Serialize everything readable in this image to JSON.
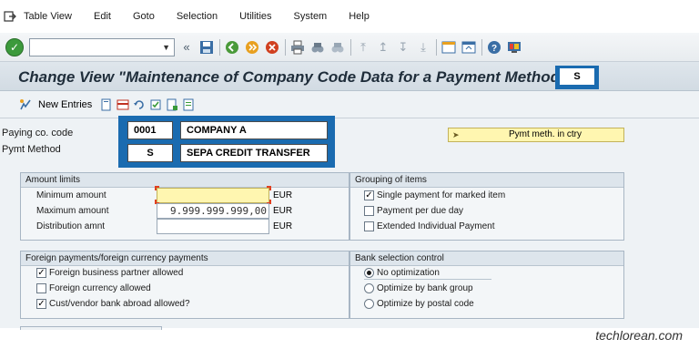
{
  "menu": {
    "items": [
      "Table View",
      "Edit",
      "Goto",
      "Selection",
      "Utilities",
      "System",
      "Help"
    ]
  },
  "toolbar": {
    "command_value": "",
    "icons": [
      "enter-icon",
      "back-icon",
      "save-icon",
      "back-green-icon",
      "exit-icon",
      "cancel-icon",
      "print-icon",
      "find-icon",
      "find-next-icon",
      "first-page-icon",
      "prev-page-icon",
      "next-page-icon",
      "last-page-icon",
      "new-session-icon",
      "shortcut-icon",
      "help-icon",
      "layout-icon"
    ]
  },
  "title": {
    "text": "Change View \"Maintenance of Company Code Data for a Payment Method\":",
    "box_value": "S"
  },
  "app_toolbar": {
    "new_entries_label": "New Entries"
  },
  "header_fields": {
    "paying_co_code_label": "Paying co. code",
    "paying_co_code_value": "0001",
    "paying_co_code_name": "COMPANY A",
    "pymt_method_label": "Pymt Method",
    "pymt_method_value": "S",
    "pymt_method_name": "SEPA CREDIT TRANSFER",
    "pymt_meth_ctry_label": "Pymt meth. in ctry"
  },
  "amount_limits": {
    "title": "Amount limits",
    "minimum_label": "Minimum amount",
    "minimum_value": "",
    "maximum_label": "Maximum amount",
    "maximum_value": "9.999.999.999,00",
    "distribution_label": "Distribution amnt",
    "distribution_value": "",
    "currency": "EUR"
  },
  "grouping": {
    "title": "Grouping of items",
    "options": [
      {
        "label": "Single payment for marked item",
        "checked": true
      },
      {
        "label": "Payment per due day",
        "checked": false
      },
      {
        "label": "Extended Individual Payment",
        "checked": false
      }
    ]
  },
  "foreign": {
    "title": "Foreign payments/foreign currency payments",
    "options": [
      {
        "label": "Foreign business partner allowed",
        "checked": true
      },
      {
        "label": "Foreign currency allowed",
        "checked": false
      },
      {
        "label": "Cust/vendor bank abroad allowed?",
        "checked": true
      }
    ]
  },
  "bank_selection": {
    "title": "Bank selection control",
    "options": [
      {
        "label": "No optimization",
        "selected": true
      },
      {
        "label": "Optimize by bank group",
        "selected": false
      },
      {
        "label": "Optimize by postal code",
        "selected": false
      }
    ]
  },
  "watermark": "techlorean.com",
  "colors": {
    "highlight_blue": "#1a6bb0",
    "required_yellow": "#fff6b0",
    "ok_green": "#3c9a3c"
  }
}
